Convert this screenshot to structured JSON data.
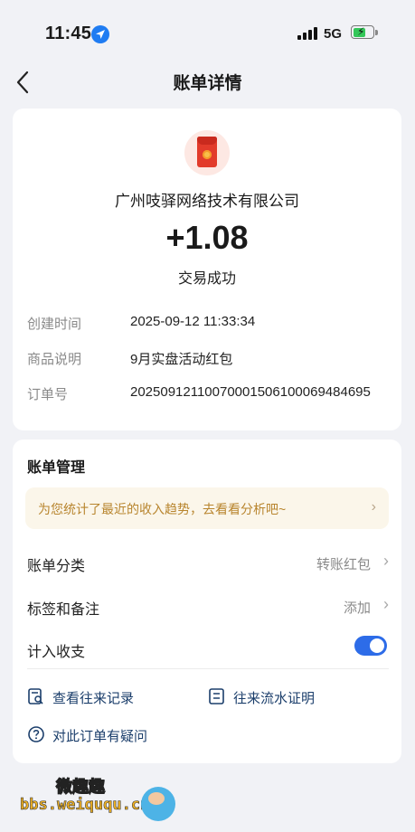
{
  "status_bar": {
    "time": "11:45",
    "network": "5G"
  },
  "nav": {
    "title": "账单详情"
  },
  "bill": {
    "merchant": "广州吱驿网络技术有限公司",
    "amount": "+1.08",
    "status": "交易成功",
    "details": [
      {
        "label": "创建时间",
        "value": "2025-09-12 11:33:34"
      },
      {
        "label": "商品说明",
        "value": "9月实盘活动红包"
      },
      {
        "label": "订单号",
        "value": "20250912110070001506100069484695"
      }
    ]
  },
  "management": {
    "title": "账单管理",
    "banner_text": "为您统计了最近的收入趋势，去看看分析吧~",
    "category": {
      "label": "账单分类",
      "value": "转账红包"
    },
    "tags": {
      "label": "标签和备注",
      "value": "添加"
    },
    "include": {
      "label": "计入收支",
      "enabled": true
    },
    "links": {
      "history": "查看往来记录",
      "proof": "往来流水证明",
      "question": "对此订单有疑问"
    }
  },
  "watermark": {
    "top": "微趣趣",
    "bottom": "bbs.weiququ.cn"
  },
  "colors": {
    "accent": "#2d6ce8",
    "banner_text": "#b8852e",
    "link": "#1b3e6b",
    "red_packet": "#e23b2b"
  }
}
